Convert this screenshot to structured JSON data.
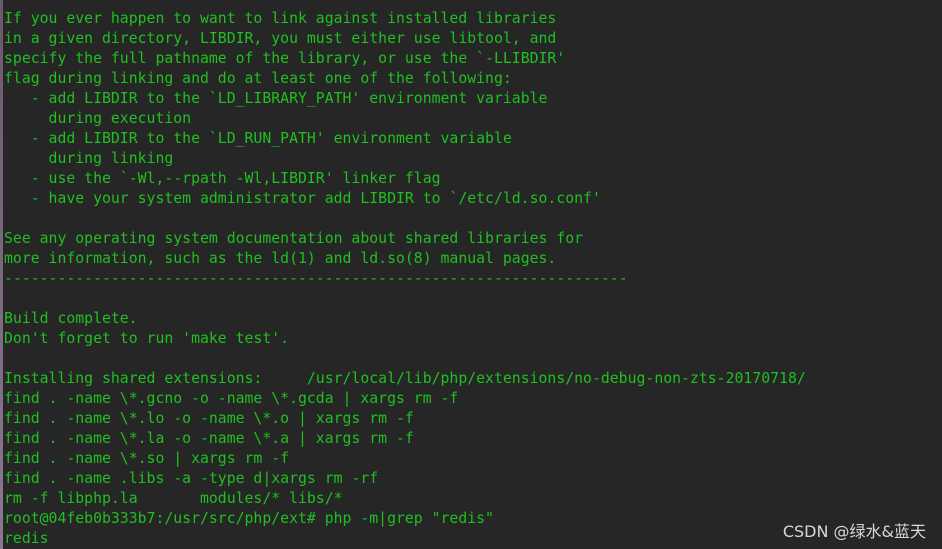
{
  "terminal": {
    "text_color": "#1fc01f",
    "background": "#262626",
    "lines": [
      "If you ever happen to want to link against installed libraries",
      "in a given directory, LIBDIR, you must either use libtool, and",
      "specify the full pathname of the library, or use the `-LLIBDIR'",
      "flag during linking and do at least one of the following:",
      "   - add LIBDIR to the `LD_LIBRARY_PATH' environment variable",
      "     during execution",
      "   - add LIBDIR to the `LD_RUN_PATH' environment variable",
      "     during linking",
      "   - use the `-Wl,--rpath -Wl,LIBDIR' linker flag",
      "   - have your system administrator add LIBDIR to `/etc/ld.so.conf'",
      "",
      "See any operating system documentation about shared libraries for",
      "more information, such as the ld(1) and ld.so(8) manual pages.",
      "----------------------------------------------------------------------",
      "",
      "Build complete.",
      "Don't forget to run 'make test'.",
      "",
      "Installing shared extensions:     /usr/local/lib/php/extensions/no-debug-non-zts-20170718/",
      "find . -name \\*.gcno -o -name \\*.gcda | xargs rm -f",
      "find . -name \\*.lo -o -name \\*.o | xargs rm -f",
      "find . -name \\*.la -o -name \\*.a | xargs rm -f",
      "find . -name \\*.so | xargs rm -f",
      "find . -name .libs -a -type d|xargs rm -rf",
      "rm -f libphp.la       modules/* libs/*",
      "root@04feb0b333b7:/usr/src/php/ext# php -m|grep \"redis\"",
      "redis"
    ]
  },
  "watermark": "CSDN @绿水&蓝天"
}
